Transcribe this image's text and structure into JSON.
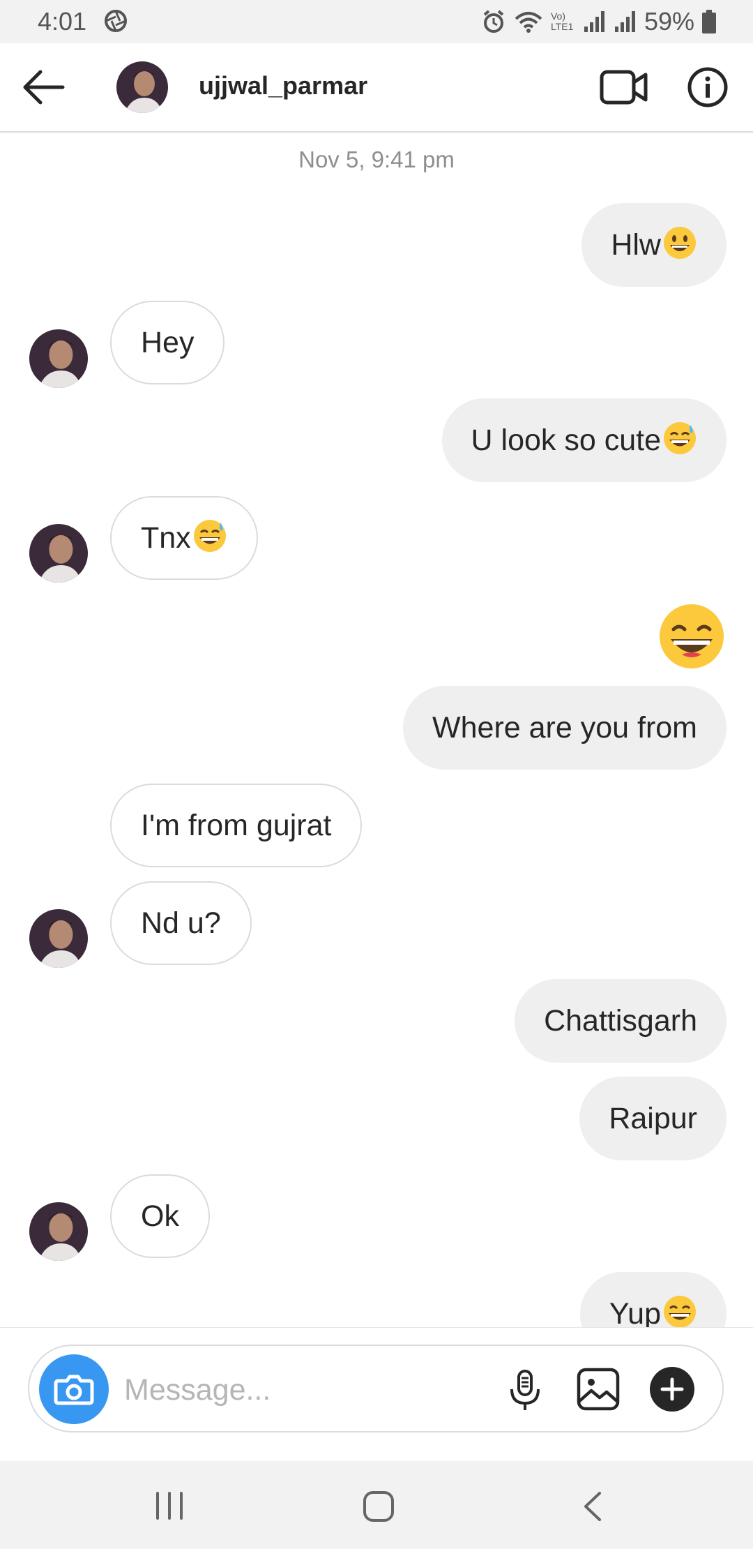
{
  "status_bar": {
    "time": "4:01",
    "battery": "59%",
    "network_label": "Vo) LTE1"
  },
  "header": {
    "username": "ujjwal_parmar"
  },
  "chat": {
    "timestamp": "Nov 5, 9:41 pm",
    "messages": [
      {
        "from": "me",
        "text": "Hlw",
        "emoji": "grinning-face"
      },
      {
        "from": "them",
        "text": "Hey"
      },
      {
        "from": "me",
        "text": "U look so cute",
        "emoji": "grinning-sweat-face"
      },
      {
        "from": "them",
        "text": "Tnx",
        "emoji": "grinning-sweat-face"
      },
      {
        "from": "me",
        "text": "",
        "emoji": "grinning-squinting-face"
      },
      {
        "from": "me",
        "text": "Where are you from"
      },
      {
        "from": "them",
        "text": "I'm from gujrat"
      },
      {
        "from": "them",
        "text": "Nd u?"
      },
      {
        "from": "me",
        "text": "Chattisgarh"
      },
      {
        "from": "me",
        "text": "Raipur"
      },
      {
        "from": "them",
        "text": "Ok"
      },
      {
        "from": "me",
        "text": "Yup",
        "emoji": "grinning-squinting-face"
      }
    ]
  },
  "composer": {
    "placeholder": "Message..."
  },
  "colors": {
    "accent": "#3897f0",
    "sent_bubble": "#efefef",
    "received_border": "#dbdbdb",
    "text": "#262626",
    "muted": "#8e8e8e"
  }
}
